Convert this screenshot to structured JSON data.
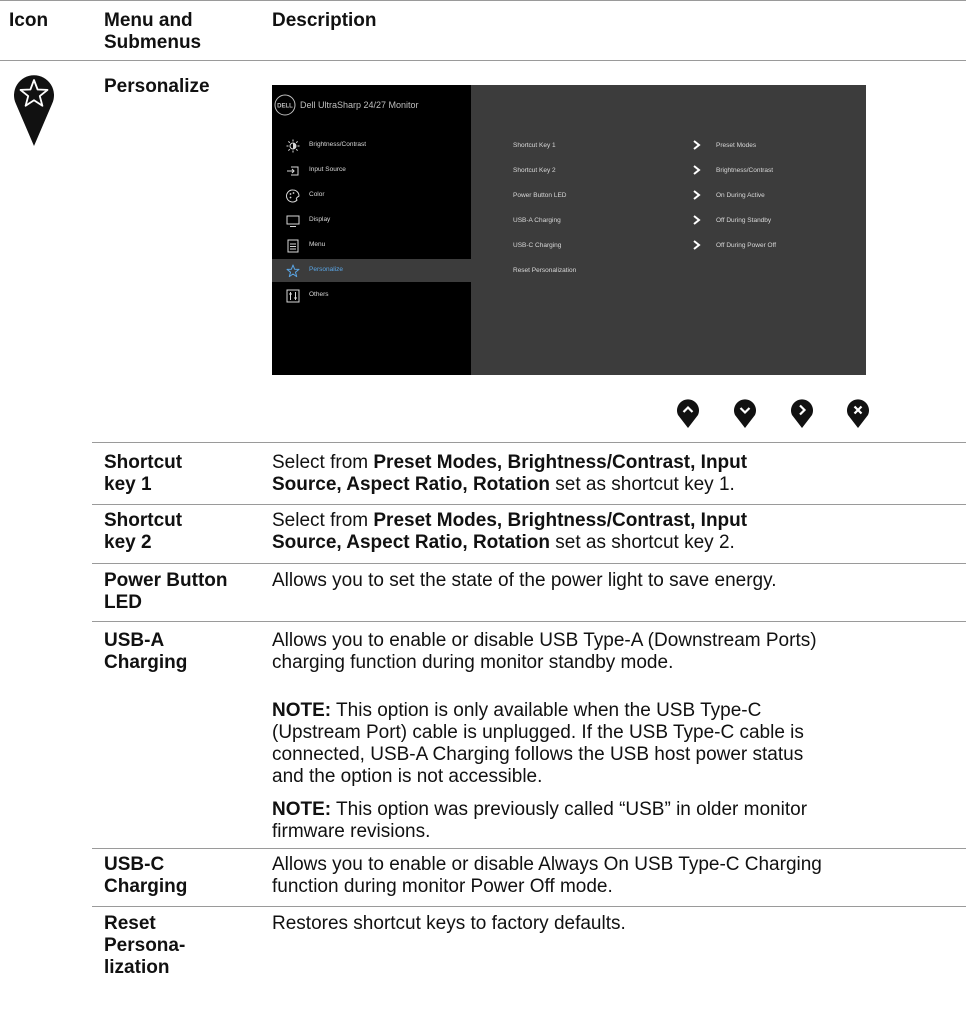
{
  "header": {
    "icon": "Icon",
    "menu_line1": "Menu and",
    "menu_line2": "Submenus",
    "description": "Description"
  },
  "section": {
    "icon": "personalize-star-icon",
    "title": "Personalize"
  },
  "osd": {
    "title": "Dell UltraSharp 24/27 Monitor",
    "logo_text": "DELL",
    "menu": [
      {
        "label": "Brightness/Contrast",
        "icon": "brightness-icon"
      },
      {
        "label": "Input Source",
        "icon": "input-source-icon"
      },
      {
        "label": "Color",
        "icon": "color-icon"
      },
      {
        "label": "Display",
        "icon": "display-icon"
      },
      {
        "label": "Menu",
        "icon": "menu-icon"
      },
      {
        "label": "Personalize",
        "icon": "star-icon",
        "active": true
      },
      {
        "label": "Others",
        "icon": "others-icon"
      }
    ],
    "submenu": [
      {
        "label": "Shortcut Key 1",
        "value": "Preset Modes"
      },
      {
        "label": "Shortcut Key 2",
        "value": "Brightness/Contrast"
      },
      {
        "label": "Power Button LED",
        "value": "On During Active"
      },
      {
        "label": "USB-A Charging",
        "value": "Off During Standby"
      },
      {
        "label": "USB-C Charging",
        "value": "Off During Power Off"
      },
      {
        "label": "Reset Personalization",
        "value": ""
      }
    ],
    "active_color": "#5aa6e6",
    "nav_buttons": [
      "up-icon",
      "down-icon",
      "right-icon",
      "close-icon"
    ]
  },
  "rows": [
    {
      "name_lines": [
        "Shortcut",
        "key 1"
      ],
      "desc": [
        {
          "t": "Select from "
        },
        {
          "t": "Preset Modes, Brightness/Contrast, Input",
          "b": true
        },
        {
          "br": true
        },
        {
          "t": "Source, Aspect Ratio, Rotation",
          "b": true
        },
        {
          "t": " set as shortcut key 1."
        }
      ]
    },
    {
      "name_lines": [
        "Shortcut",
        "key 2"
      ],
      "desc": [
        {
          "t": "Select from "
        },
        {
          "t": "Preset Modes, Brightness/Contrast, Input",
          "b": true
        },
        {
          "br": true
        },
        {
          "t": "Source, Aspect Ratio, Rotation",
          "b": true
        },
        {
          "t": " set as shortcut key 2."
        }
      ]
    },
    {
      "name_lines": [
        "Power Button",
        "LED"
      ],
      "desc": [
        {
          "t": "Allows you to set the state of the power light to save energy."
        }
      ]
    },
    {
      "name_lines": [
        "USB-A",
        "Charging"
      ],
      "desc": [
        {
          "t": "Allows you to enable or disable USB Type-A (Downstream Ports)"
        },
        {
          "br": true
        },
        {
          "t": "charging function during monitor standby mode."
        }
      ],
      "notes": [
        {
          "label": "NOTE:",
          "lines": [
            " This option is only available when the USB Type-C",
            "(Upstream Port) cable is unplugged. If the USB Type-C cable is",
            "connected, USB-A Charging follows the USB host power status",
            "and the option is not accessible."
          ]
        },
        {
          "label": "NOTE:",
          "lines": [
            " This option was previously called “USB” in older monitor",
            "firmware revisions."
          ]
        }
      ]
    },
    {
      "name_lines": [
        "USB-C",
        "Charging"
      ],
      "desc": [
        {
          "t": "Allows you to enable or disable Always On USB Type-C Charging"
        },
        {
          "br": true
        },
        {
          "t": "function during monitor Power Off mode."
        }
      ]
    },
    {
      "name_lines": [
        "Reset",
        "Persona-",
        "lization"
      ],
      "desc": [
        {
          "t": "Restores shortcut keys to factory defaults."
        }
      ]
    }
  ]
}
